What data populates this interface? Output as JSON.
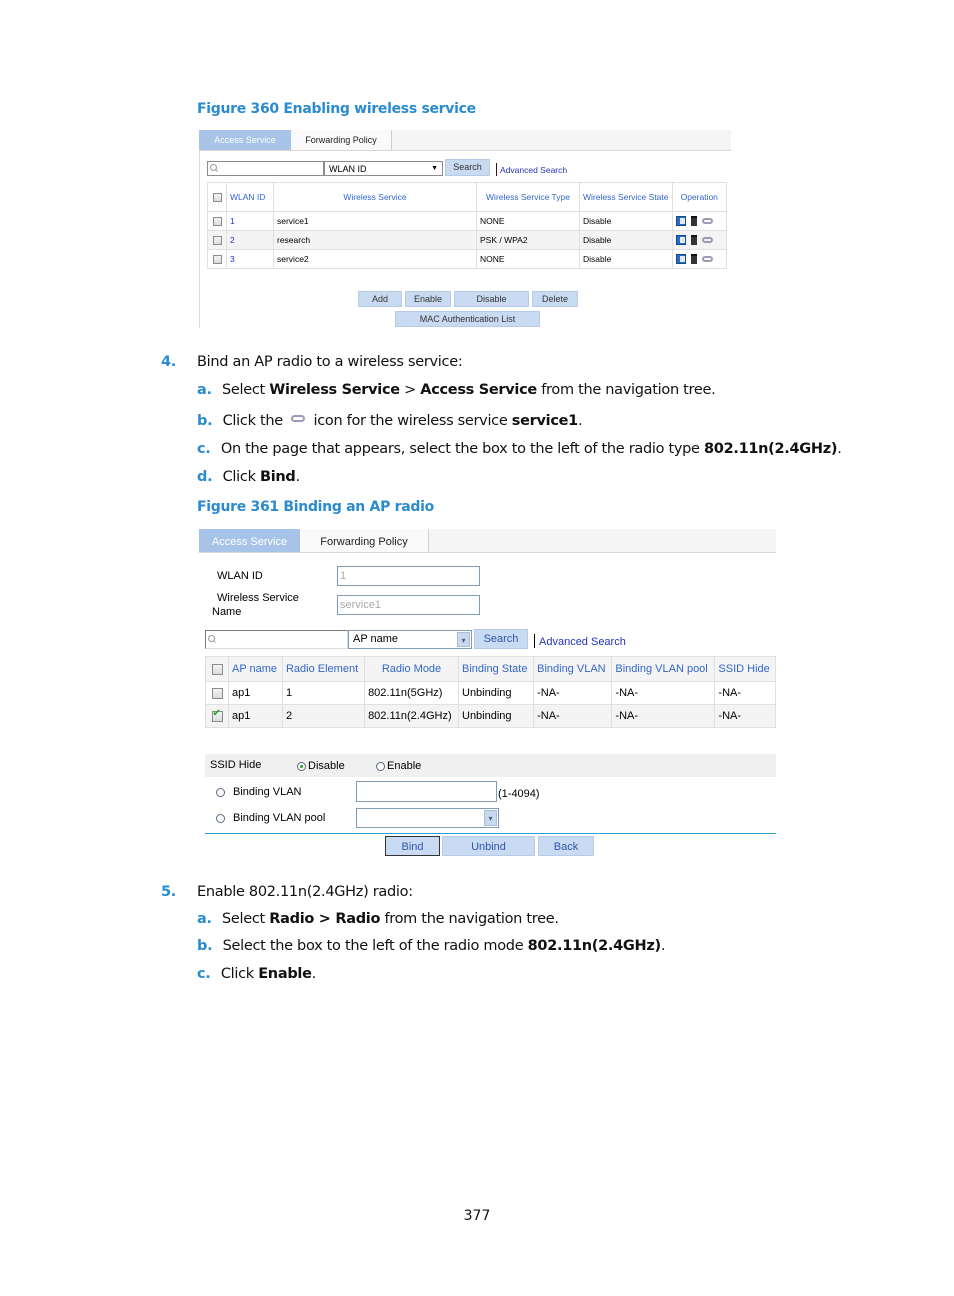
{
  "figure360": {
    "caption": "Figure 360 Enabling wireless service",
    "tabs": [
      {
        "label": "Access Service",
        "active": true
      },
      {
        "label": "Forwarding Policy",
        "active": false
      }
    ],
    "search": {
      "query": "",
      "field_select": "WLAN ID",
      "search_button": "Search",
      "advanced_search": "Advanced Search"
    },
    "table": {
      "headers": [
        "WLAN ID",
        "Wireless Service",
        "Wireless Service Type",
        "Wireless Service State",
        "Operation"
      ],
      "rows": [
        {
          "id": "1",
          "service": "service1",
          "type": "NONE",
          "state": "Disable",
          "checked": false
        },
        {
          "id": "2",
          "service": "research",
          "type": "PSK / WPA2",
          "state": "Disable",
          "checked": false
        },
        {
          "id": "3",
          "service": "service2",
          "type": "NONE",
          "state": "Disable",
          "checked": false
        }
      ],
      "operation_icons": [
        "edit-icon",
        "delete-icon",
        "bind-link-icon"
      ]
    },
    "buttons": {
      "add": "Add",
      "enable": "Enable",
      "disable": "Disable",
      "delete": "Delete",
      "mac_auth": "MAC Authentication List"
    }
  },
  "step4": {
    "num": "4.",
    "text": "Bind an AP radio to a wireless service:",
    "a": {
      "label": "a.",
      "pre": "Select ",
      "b1": "Wireless Service",
      "mid": " > ",
      "b2": "Access Service",
      "post": " from the navigation tree."
    },
    "b": {
      "label": "b.",
      "pre": "Click the ",
      "icon": "bind-link-icon",
      "mid": " icon for the wireless service ",
      "b1": "service1",
      "post": "."
    },
    "c": {
      "label": "c.",
      "pre": "On the page that appears, select the box to the left of the radio type ",
      "b1": "802.11n(2.4GHz)",
      "post": "."
    },
    "d": {
      "label": "d.",
      "pre": "Click ",
      "b1": "Bind",
      "post": "."
    }
  },
  "figure361": {
    "caption": "Figure 361 Binding an AP radio",
    "tabs": [
      {
        "label": "Access Service",
        "active": true
      },
      {
        "label": "Forwarding Policy",
        "active": false
      }
    ],
    "wlan_id_label": "WLAN ID",
    "wlan_id_value": "1",
    "service_name_label_1": "Wireless Service",
    "service_name_label_2": "Name",
    "service_name_value": "service1",
    "search": {
      "query": "",
      "field_select": "AP name",
      "search_button": "Search",
      "advanced_search": "Advanced Search"
    },
    "table": {
      "headers": [
        "AP name",
        "Radio Element",
        "Radio Mode",
        "Binding State",
        "Binding VLAN",
        "Binding VLAN pool",
        "SSID Hide"
      ],
      "rows": [
        {
          "ap": "ap1",
          "radio": "1",
          "mode": "802.11n(5GHz)",
          "state": "Unbinding",
          "vlan": "-NA-",
          "pool": "-NA-",
          "ssid": "-NA-",
          "checked": false
        },
        {
          "ap": "ap1",
          "radio": "2",
          "mode": "802.11n(2.4GHz)",
          "state": "Unbinding",
          "vlan": "-NA-",
          "pool": "-NA-",
          "ssid": "-NA-",
          "checked": true
        }
      ]
    },
    "ssid_hide": {
      "label": "SSID Hide",
      "options": [
        "Disable",
        "Enable"
      ],
      "selected": "Disable"
    },
    "binding_vlan": {
      "label": "Binding VLAN",
      "value": "",
      "hint": "(1-4094)",
      "selected": false
    },
    "binding_vlan_pool": {
      "label": "Binding VLAN pool",
      "value": "",
      "selected": false
    },
    "buttons": {
      "bind": "Bind",
      "unbind": "Unbind",
      "back": "Back"
    }
  },
  "step5": {
    "num": "5.",
    "text": "Enable 802.11n(2.4GHz) radio:",
    "a": {
      "label": "a.",
      "pre": "Select ",
      "b1": "Radio > Radio",
      "post": " from the navigation tree."
    },
    "b": {
      "label": "b.",
      "pre": "Select the box to the left of the radio mode ",
      "b1": "802.11n(2.4GHz)",
      "post": "."
    },
    "c": {
      "label": "c.",
      "pre": "Click ",
      "b1": "Enable",
      "post": "."
    }
  },
  "page_number": "377"
}
